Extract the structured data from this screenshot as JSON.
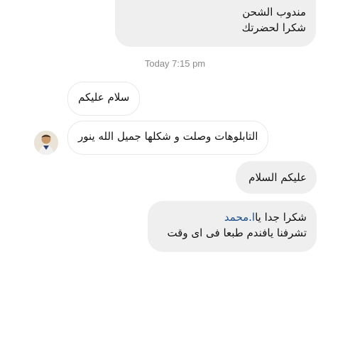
{
  "messages": {
    "top_out": {
      "line1": "مندوب الشحن",
      "line2": "شكرا لحضرتك"
    },
    "timestamp": "Today 7:15 pm",
    "in1": "سلام عليكم",
    "in2": "التابلوهات وصلت و شكلها جميل الله ينور",
    "out2": "عليكم السلام",
    "out3": {
      "line1_before": "شكرا جدا يا",
      "mention": "ا.محمد",
      "line2": "تشرفنا يافندم طبعا فى اى وقت"
    }
  },
  "avatar": {
    "icon": "person-photo"
  }
}
